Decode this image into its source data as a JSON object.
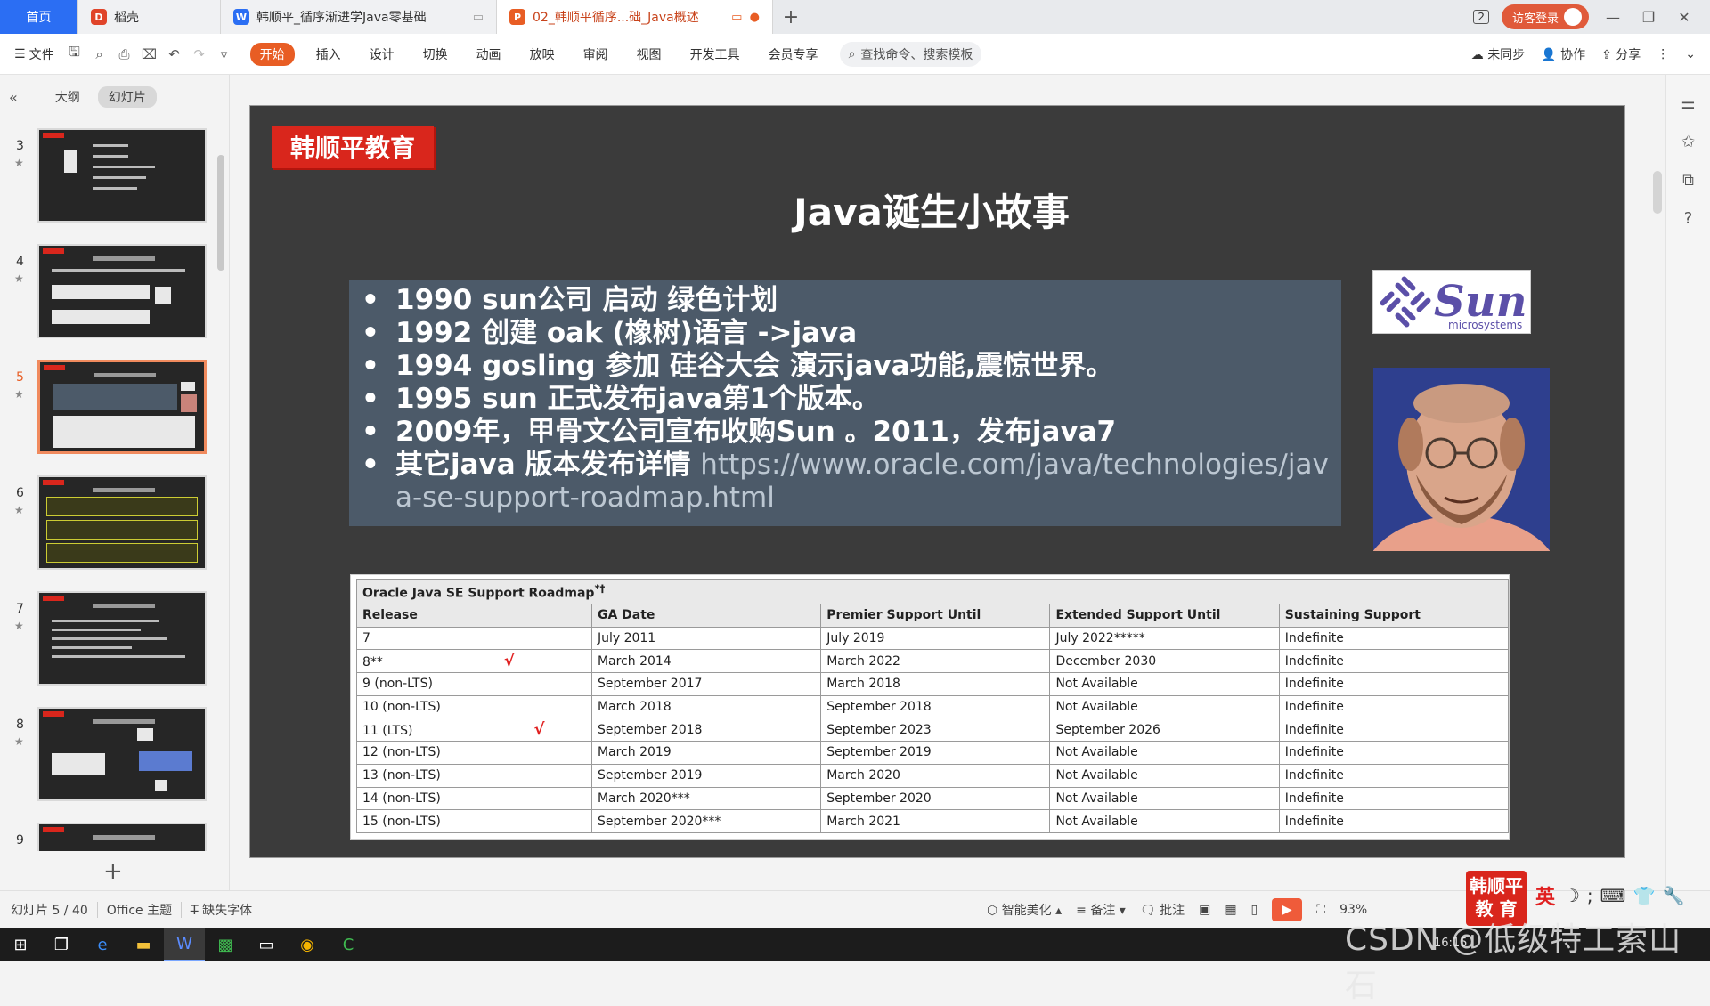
{
  "tabs": {
    "home": "首页",
    "daoke": "稻壳",
    "doc1": "韩顺平_循序渐进学Java零基础",
    "doc2": "02_韩顺平循序...础_Java概述",
    "new_tab": "+",
    "window_count": "2",
    "login": "访客登录"
  },
  "ribbon": {
    "file": "文件",
    "start": "开始",
    "menus": [
      "插入",
      "设计",
      "切换",
      "动画",
      "放映",
      "审阅",
      "视图",
      "开发工具",
      "会员专享"
    ],
    "search_placeholder": "查找命令、搜索模板",
    "unsync": "未同步",
    "collab": "协作",
    "share": "分享"
  },
  "left_panel": {
    "outline": "大纲",
    "slides": "幻灯片",
    "thumb_numbers": [
      "3",
      "4",
      "5",
      "6",
      "7",
      "8",
      "9"
    ],
    "add": "+"
  },
  "slide": {
    "brand": "韩顺平教育",
    "title": "Java诞生小故事",
    "bullets": [
      {
        "text": "1990 sun公司 启动 绿色计划",
        "url": ""
      },
      {
        "text": "1992 创建 oak (橡树)语言 ->java",
        "url": ""
      },
      {
        "text": "1994 gosling 参加 硅谷大会 演示java功能,震惊世界。",
        "url": ""
      },
      {
        "text": "1995 sun 正式发布java第1个版本。",
        "url": ""
      },
      {
        "text": "2009年，甲骨文公司宣布收购Sun 。2011，发布java7",
        "url": ""
      },
      {
        "text": "其它java 版本发布详情 ",
        "url": "https://www.oracle.com/java/technologies/java-se-support-roadmap.html"
      }
    ],
    "sun_word": "Sun",
    "sun_sub": "microsystems",
    "bullet_mark": "•",
    "table": {
      "caption": "Oracle Java SE Support Roadmap",
      "caption_sup": "*†",
      "headers": [
        "Release",
        "GA Date",
        "Premier Support Until",
        "Extended Support Until",
        "Sustaining Support"
      ],
      "check_mark": "√",
      "rows": [
        [
          "7",
          "July 2011",
          "July 2019",
          "July 2022*****",
          "Indefinite"
        ],
        [
          "8**",
          "March 2014",
          "March 2022",
          "December 2030",
          "Indefinite"
        ],
        [
          "9 (non-LTS)",
          "September 2017",
          "March 2018",
          "Not Available",
          "Indefinite"
        ],
        [
          "10 (non-LTS)",
          "March 2018",
          "September 2018",
          "Not Available",
          "Indefinite"
        ],
        [
          "11 (LTS)",
          "September 2018",
          "September 2023",
          "September 2026",
          "Indefinite"
        ],
        [
          "12 (non-LTS)",
          "March 2019",
          "September 2019",
          "Not Available",
          "Indefinite"
        ],
        [
          "13 (non-LTS)",
          "September 2019",
          "March 2020",
          "Not Available",
          "Indefinite"
        ],
        [
          "14 (non-LTS)",
          "March 2020***",
          "September 2020",
          "Not Available",
          "Indefinite"
        ],
        [
          "15 (non-LTS)",
          "September 2020***",
          "March 2021",
          "Not Available",
          "Indefinite"
        ]
      ],
      "checked_rows": [
        1,
        4
      ]
    }
  },
  "status": {
    "slide_pos": "幻灯片 5 / 40",
    "theme": "Office 主题",
    "missing_font": "缺失字体",
    "beautify": "智能美化",
    "notes": "备注",
    "comment": "批注",
    "zoom": "93%"
  },
  "overlay": {
    "logo_line1": "韩顺平",
    "logo_line2": "教 育",
    "ime": "英",
    "watermark": "CSDN @低级特工索山石",
    "tray_time": "16:15"
  },
  "colors": {
    "accent": "#e85d24",
    "brand_red": "#d9261c",
    "slide_bg": "#3b3b3b",
    "content_box": "#4c5a69"
  }
}
